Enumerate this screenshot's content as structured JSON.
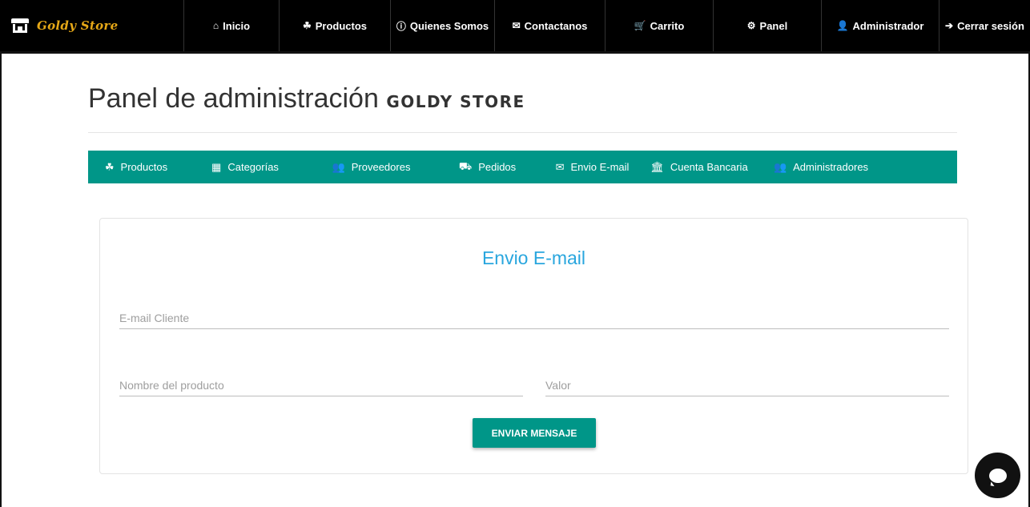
{
  "navbar": {
    "brand": "Goldy Store",
    "items": [
      {
        "label": "Inicio",
        "icon": "home-icon",
        "glyph": "⌂"
      },
      {
        "label": "Productos",
        "icon": "cubes-icon",
        "glyph": "☘"
      },
      {
        "label": "Quienes Somos",
        "icon": "info-circle-icon",
        "glyph": "ⓘ"
      },
      {
        "label": "Contactanos",
        "icon": "envelope-icon",
        "glyph": "✉"
      },
      {
        "label": "Carrito",
        "icon": "cart-icon",
        "glyph": "🛒"
      },
      {
        "label": "Panel",
        "icon": "cogs-icon",
        "glyph": "⚙"
      },
      {
        "label": "Administrador",
        "icon": "user-cog-icon",
        "glyph": "👤"
      },
      {
        "label": "Cerrar sesión",
        "icon": "sign-out-icon",
        "glyph": "➔"
      }
    ]
  },
  "page": {
    "title": "Panel de administración",
    "title_brand": "GOLDY STORE"
  },
  "subnav": {
    "color": "#009688",
    "items": [
      {
        "label": "Productos",
        "icon": "cubes-icon",
        "glyph": "☘"
      },
      {
        "label": "Categorías",
        "icon": "boxes-icon",
        "glyph": "▦"
      },
      {
        "label": "Proveedores",
        "icon": "users-icon",
        "glyph": "👥"
      },
      {
        "label": "Pedidos",
        "icon": "dolly-icon",
        "glyph": "⛟"
      },
      {
        "label": "Envio E-mail",
        "icon": "envelope-icon",
        "glyph": "✉"
      },
      {
        "label": "Cuenta Bancaria",
        "icon": "bank-icon",
        "glyph": "🏛"
      },
      {
        "label": "Administradores",
        "icon": "users-cog-icon",
        "glyph": "👥"
      }
    ]
  },
  "form": {
    "title": "Envio E-mail",
    "email_placeholder": "E-mail Cliente",
    "product_placeholder": "Nombre del producto",
    "value_placeholder": "Valor",
    "submit_label": "ENVIAR MENSAJE",
    "title_color": "#29a6de"
  },
  "chat": {
    "icon": "chat-bubble-icon"
  }
}
